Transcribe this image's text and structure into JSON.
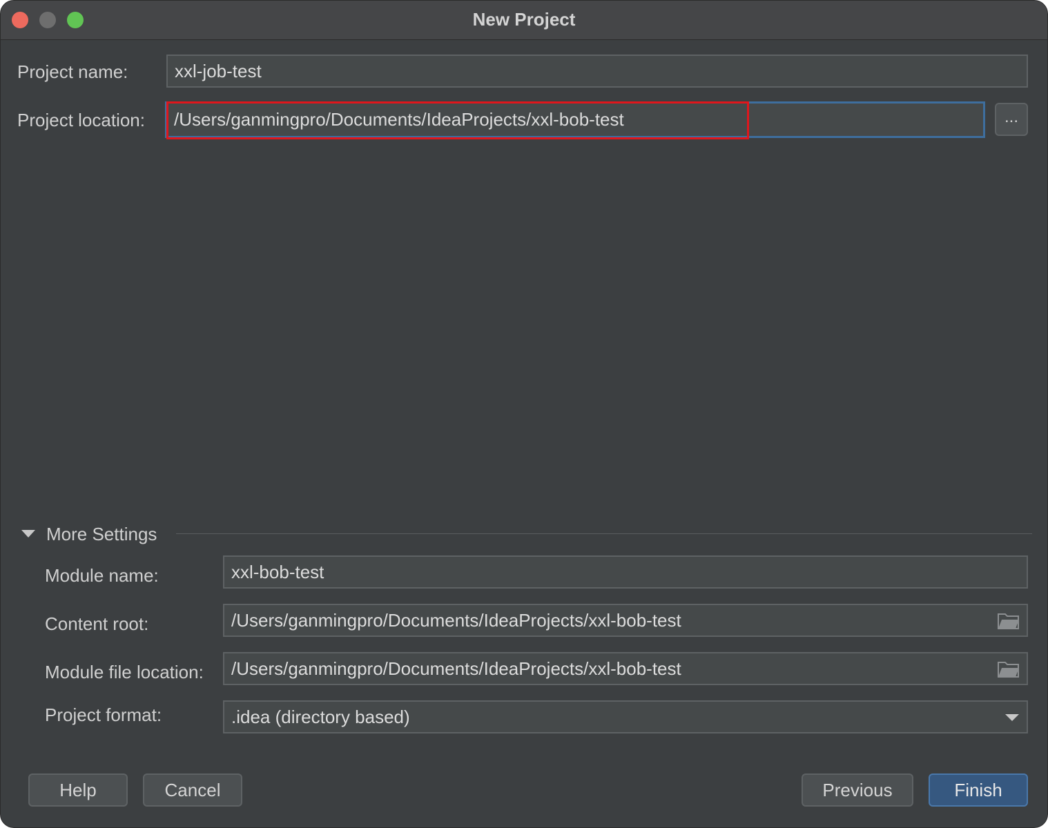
{
  "window": {
    "title": "New Project"
  },
  "project": {
    "name_label": "Project name:",
    "name_value": "xxl-job-test",
    "location_label": "Project location:",
    "location_value": "/Users/ganmingpro/Documents/IdeaProjects/xxl-bob-test",
    "browse_label": "..."
  },
  "more_settings": {
    "header": "More Settings",
    "module_name_label": "Module name:",
    "module_name_value": "xxl-bob-test",
    "content_root_label": "Content root:",
    "content_root_value": "/Users/ganmingpro/Documents/IdeaProjects/xxl-bob-test",
    "module_file_location_label": "Module file location:",
    "module_file_location_value": "/Users/ganmingpro/Documents/IdeaProjects/xxl-bob-test",
    "project_format_label": "Project format:",
    "project_format_value": ".idea (directory based)"
  },
  "buttons": {
    "help": "Help",
    "cancel": "Cancel",
    "previous": "Previous",
    "finish": "Finish"
  },
  "icons": {
    "folder": "folder-icon",
    "dropdown": "chevron-down-icon",
    "collapse": "triangle-down-icon"
  },
  "colors": {
    "background": "#3c3f41",
    "field": "#45494a",
    "focus_border": "#3e6e9e",
    "highlight_annotation": "#e0161c",
    "primary_button": "#365880"
  }
}
